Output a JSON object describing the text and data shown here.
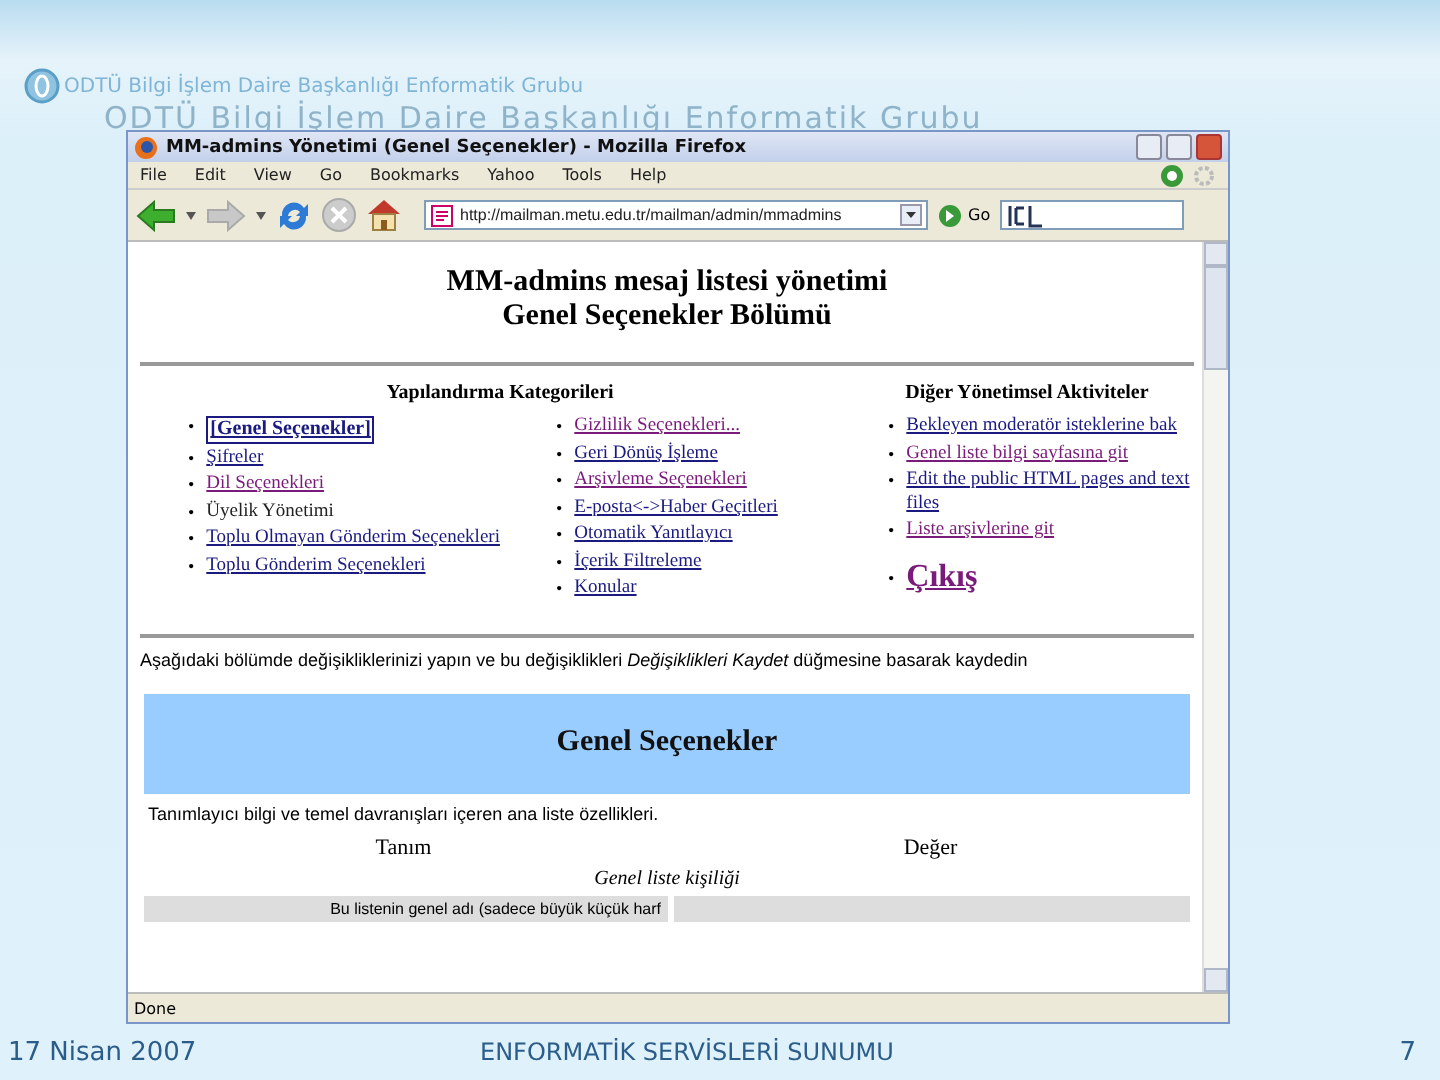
{
  "slide": {
    "header_title": "ODTÜ Bilgi İşlem Daire Başkanlığı Enformatik Grubu",
    "header_echo": "ODTÜ Bilgi İşlem Daire Başkanlığı Enformatik Grubu",
    "date": "17 Nisan 2007",
    "footer_title": "ENFORMATİK SERVİSLERİ SUNUMU",
    "page_number": "7"
  },
  "browser": {
    "title": "MM-admins Yönetimi (Genel Seçenekler) - Mozilla Firefox",
    "menu": [
      "File",
      "Edit",
      "View",
      "Go",
      "Bookmarks",
      "Yahoo",
      "Tools",
      "Help"
    ],
    "url": "http://mailman.metu.edu.tr/mailman/admin/mmadmins",
    "go_label": "Go",
    "status": "Done"
  },
  "page": {
    "heading": [
      "MM-admins mesaj listesi yönetimi",
      "Genel Seçenekler Bölümü"
    ],
    "bullet": "•",
    "config_title": "Yapılandırma Kategorileri",
    "config_columns": [
      [
        {
          "text": "[Genel Seçenekler]",
          "kind": "current"
        },
        {
          "text": "Şifreler",
          "kind": "link"
        },
        {
          "text": "Dil Seçenekleri",
          "kind": "visited"
        },
        {
          "text": "Üyelik Yönetimi",
          "kind": "plain"
        },
        {
          "text": "Toplu Olmayan Gönderim Seçenekleri",
          "kind": "link"
        },
        {
          "text": "Toplu Gönderim Seçenekleri",
          "kind": "link"
        }
      ],
      [
        {
          "text": "Gizlilik Seçenekleri...",
          "kind": "visited"
        },
        {
          "text": "Geri Dönüş İşleme",
          "kind": "link"
        },
        {
          "text": "Arşivleme Seçenekleri",
          "kind": "visited"
        },
        {
          "text": "E-posta<->Haber Geçitleri",
          "kind": "link"
        },
        {
          "text": "Otomatik Yanıtlayıcı",
          "kind": "link"
        },
        {
          "text": "İçerik Filtreleme",
          "kind": "link"
        },
        {
          "text": "Konular",
          "kind": "link"
        }
      ]
    ],
    "other_title": "Diğer Yönetimsel Aktiviteler",
    "other_items": [
      {
        "text": "Bekleyen moderatör isteklerine bak",
        "kind": "link"
      },
      {
        "text": "Genel liste bilgi sayfasına git",
        "kind": "visited"
      },
      {
        "text": "Edit the public HTML pages and text files",
        "kind": "link"
      },
      {
        "text": "Liste arşivlerine git",
        "kind": "visited"
      }
    ],
    "logout": "Çıkış",
    "instructions": "Aşağıdaki bölümde değişikliklerinizi yapın ve bu değişiklikleri *Değişiklikleri Kaydet* düğmesine basarak kaydedin",
    "section_title": "Genel Seçenekler",
    "section_description": "Tanımlayıcı bilgi ve temel davranışları içeren ana liste özellikleri.",
    "columns": [
      "Tanım",
      "Değer"
    ],
    "group_title": "Genel liste kişiliği",
    "first_row_label": "Bu listenin genel adı (sadece büyük küçük harf"
  }
}
